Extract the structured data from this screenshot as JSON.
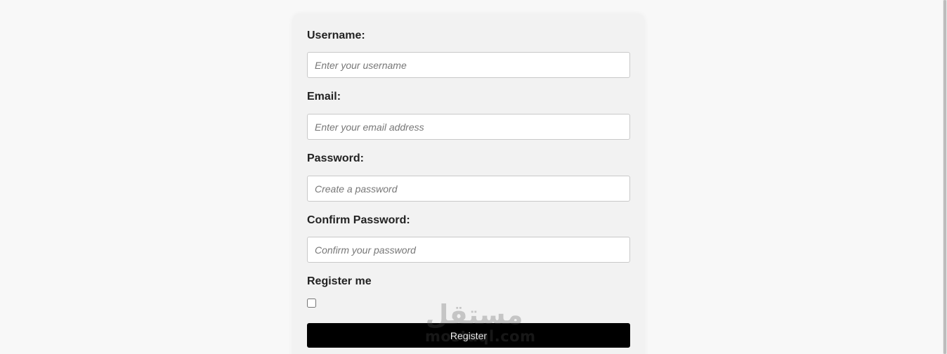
{
  "form": {
    "fields": [
      {
        "label": "Username:",
        "placeholder": "Enter your username"
      },
      {
        "label": "Email:",
        "placeholder": "Enter your email address"
      },
      {
        "label": "Password:",
        "placeholder": "Create a password"
      },
      {
        "label": "Confirm Password:",
        "placeholder": "Confirm your password"
      }
    ],
    "register_checkbox_label": "Register me",
    "register_checked": false,
    "submit_label": "Register"
  },
  "watermark": {
    "arabic": "مستقل",
    "latin": "mostaql.com"
  },
  "colors": {
    "page_background": "#f8f8f8",
    "card_background": "#f2f2f2",
    "button_background": "#000000",
    "button_text": "#ffffff"
  }
}
